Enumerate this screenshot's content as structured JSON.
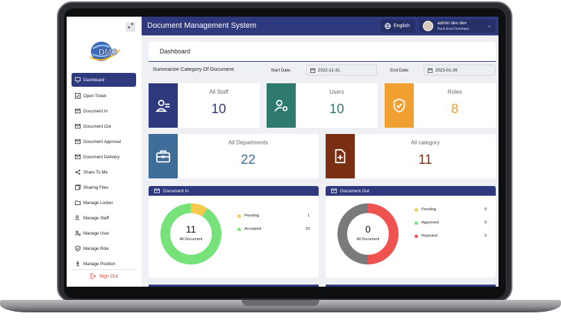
{
  "app": {
    "title": "Document Management System"
  },
  "topbar": {
    "language": "English",
    "user_name": "admin dev dev",
    "user_role": "Back-End Developer"
  },
  "logo": {
    "text": "DMS"
  },
  "sidebar": {
    "items": [
      {
        "label": "Dashboard",
        "icon": "monitor-icon",
        "active": true
      },
      {
        "label": "Open Ticket",
        "icon": "check-square-icon"
      },
      {
        "label": "Document In",
        "icon": "mail-in-icon"
      },
      {
        "label": "Document Out",
        "icon": "mail-out-icon"
      },
      {
        "label": "Document Approval",
        "icon": "mail-check-icon"
      },
      {
        "label": "Document Delivery",
        "icon": "mail-delivery-icon"
      },
      {
        "label": "Share To Me",
        "icon": "share-icon"
      },
      {
        "label": "Sharing Files",
        "icon": "files-icon"
      },
      {
        "label": "Manage Locker",
        "icon": "folder-icon"
      },
      {
        "label": "Manage Staff",
        "icon": "staff-icon"
      },
      {
        "label": "Manage User",
        "icon": "user-gear-icon"
      },
      {
        "label": "Manage Role",
        "icon": "shield-check-icon"
      },
      {
        "label": "Manage Position",
        "icon": "person-position-icon"
      }
    ],
    "sign_out": "Sign Out"
  },
  "dashboard": {
    "title": "Dashboard",
    "summary_label": "Summarize Category Of Document",
    "start_date_label": "Start Date:",
    "start_date": "2022-12-31",
    "end_date_label": "End Date:",
    "end_date": "2023-01-26"
  },
  "stats": {
    "staff": {
      "label": "All Staff",
      "value": "10",
      "color": "#2f3a7e"
    },
    "users": {
      "label": "Users",
      "value": "10",
      "color": "#2f7a6e"
    },
    "roles": {
      "label": "Roles",
      "value": "8",
      "color": "#f0a030"
    },
    "departments": {
      "label": "All Departments",
      "value": "22",
      "color": "#3f6d9a"
    },
    "category": {
      "label": "All category",
      "value": "11",
      "color": "#7a2e12"
    }
  },
  "document_in": {
    "title": "Document In",
    "total": "11",
    "total_label": "All Document",
    "legend": [
      {
        "name": "Pending",
        "value": "1",
        "color": "#f5c94a"
      },
      {
        "name": "Accepted",
        "value": "10",
        "color": "#78e27a"
      }
    ]
  },
  "document_out": {
    "title": "Document Out",
    "total": "0",
    "total_label": "All Document",
    "legend": [
      {
        "name": "Pending",
        "value": "0",
        "color": "#f5c94a"
      },
      {
        "name": "Approved",
        "value": "0",
        "color": "#78e27a"
      },
      {
        "name": "Rejected",
        "value": "0",
        "color": "#ef5350"
      }
    ]
  },
  "chart_data": [
    {
      "type": "pie",
      "title": "Document In",
      "categories": [
        "Pending",
        "Accepted"
      ],
      "values": [
        1,
        10
      ],
      "colors": [
        "#f5c94a",
        "#78e27a"
      ]
    },
    {
      "type": "pie",
      "title": "Document Out",
      "categories": [
        "Pending",
        "Approved",
        "Rejected"
      ],
      "values": [
        0,
        0,
        0
      ],
      "colors": [
        "#f5c94a",
        "#78e27a",
        "#ef5350"
      ]
    }
  ]
}
